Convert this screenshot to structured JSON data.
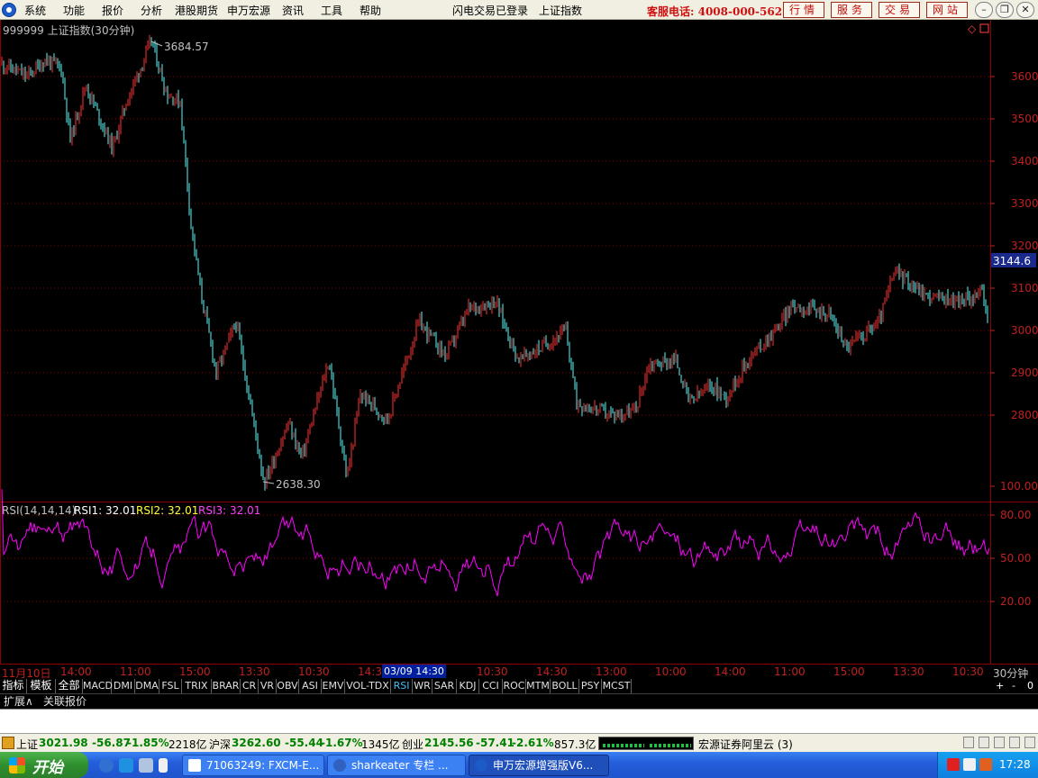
{
  "menu": {
    "items": [
      "系统",
      "功能",
      "报价",
      "分析",
      "港股期货",
      "申万宏源",
      "资讯",
      "工具",
      "帮助"
    ],
    "status": "闪电交易已登录",
    "index_name": "上证指数",
    "hotline": "客服电话: 4008-000-562",
    "buttons": [
      "行情",
      "服务",
      "交易",
      "网站"
    ]
  },
  "chart": {
    "title": "999999 上证指数(30分钟)",
    "high_label": "3684.57",
    "low_label": "2638.30",
    "last_price": "3144.6",
    "price_ticks": [
      "3600",
      "3500",
      "3400",
      "3300",
      "3200",
      "3100",
      "3000",
      "2900",
      "2800"
    ],
    "rsi_ticks": [
      "100.00",
      "80.00",
      "50.00",
      "20.00"
    ],
    "colors": {
      "up": "#ff3232",
      "down": "#54fcfc",
      "rsi": "#ff00ff",
      "grid": "#8b0000",
      "axis": "#c02020"
    }
  },
  "rsi_legend": {
    "name": "RSI(14,14,14)",
    "rsi1": "RSI1: 32.01",
    "rsi2": "RSI2: 32.01",
    "rsi3": "RSI3: 32.01"
  },
  "time_axis": {
    "labels": [
      "11月10日",
      "14:00",
      "11:00",
      "15:00",
      "13:30",
      "10:30",
      "14:3",
      "10:30",
      "14:30",
      "13:00",
      "10:00",
      "14:00",
      "11:00",
      "15:00",
      "13:30",
      "10:30"
    ],
    "cursor": "03/09 14:30",
    "unit": "30分钟"
  },
  "indicator_tabs": {
    "cn": [
      "指标",
      "模板",
      "全部"
    ],
    "items": [
      "MACD",
      "DMI",
      "DMA",
      "FSL",
      "TRIX",
      "BRAR",
      "CR",
      "VR",
      "OBV",
      "ASI",
      "EMV",
      "VOL-TDX",
      "RSI",
      "WR",
      "SAR",
      "KDJ",
      "CCI",
      "ROC",
      "MTM",
      "BOLL",
      "PSY",
      "MCST"
    ],
    "active": "RSI",
    "nav": [
      "+",
      "-",
      "0"
    ]
  },
  "ext_tabs": [
    "扩展∧",
    "关联报价"
  ],
  "market": {
    "sh_name": "上证",
    "sh_price": "3021.98",
    "sh_chg": "-56.87",
    "sh_pct": "-1.85%",
    "sh_amt": "2218亿",
    "sz_name": "沪深",
    "sz_price": "3262.60",
    "sz_chg": "-55.44",
    "sz_pct": "-1.67%",
    "sz_amt": "1345亿",
    "cy_name": "创业",
    "cy_price": "2145.56",
    "cy_chg": "-57.41",
    "cy_pct": "-2.61%",
    "cy_amt": "857.3亿",
    "server": "宏源证券阿里云 (3)"
  },
  "taskbar": {
    "start": "开始",
    "tasks": [
      "71063249: FXCM-E...",
      "sharkeater 专栏 ...",
      "申万宏源增强版V6..."
    ],
    "clock": "17:28"
  }
}
